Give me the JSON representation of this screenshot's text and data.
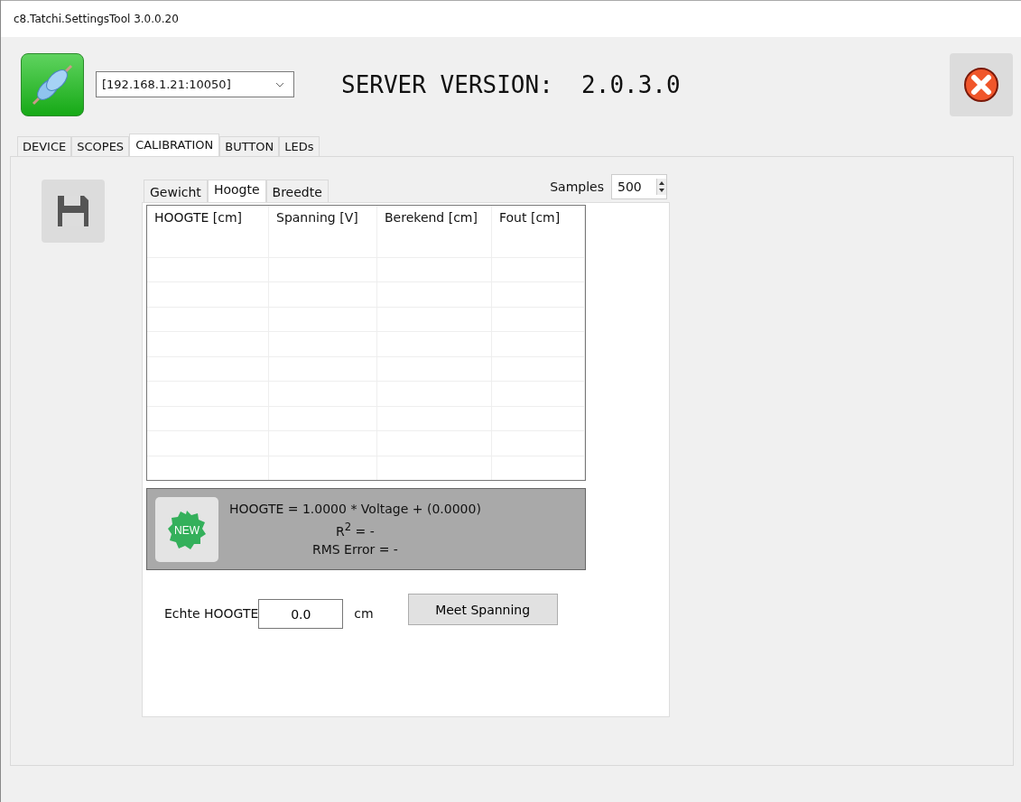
{
  "window": {
    "title": "c8.Tatchi.SettingsTool 3.0.0.20"
  },
  "connection": {
    "value": "[192.168.1.21:10050]"
  },
  "server_version": "SERVER VERSION:  2.0.3.0",
  "tabs": [
    {
      "label": "DEVICE",
      "selected": false
    },
    {
      "label": "SCOPES",
      "selected": false
    },
    {
      "label": "CALIBRATION",
      "selected": true
    },
    {
      "label": "BUTTON",
      "selected": false
    },
    {
      "label": "LEDs",
      "selected": false
    }
  ],
  "subtabs": [
    {
      "label": "Gewicht",
      "selected": false
    },
    {
      "label": "Hoogte",
      "selected": true
    },
    {
      "label": "Breedte",
      "selected": false
    }
  ],
  "samples": {
    "label": "Samples",
    "value": "500"
  },
  "table": {
    "columns": [
      "HOOGTE [cm]",
      "Spanning [V]",
      "Berekend [cm]",
      "Fout [cm]"
    ]
  },
  "formula": {
    "badge": "NEW",
    "lines": [
      "HOOGTE = 1.0000 * Voltage + (0.0000)",
      "R$^{2}$ = -",
      "RMS Error = -"
    ]
  },
  "measure": {
    "label": "Echte HOOGTE",
    "value": "0.0",
    "unit": "cm",
    "button": "Meet Spanning"
  }
}
